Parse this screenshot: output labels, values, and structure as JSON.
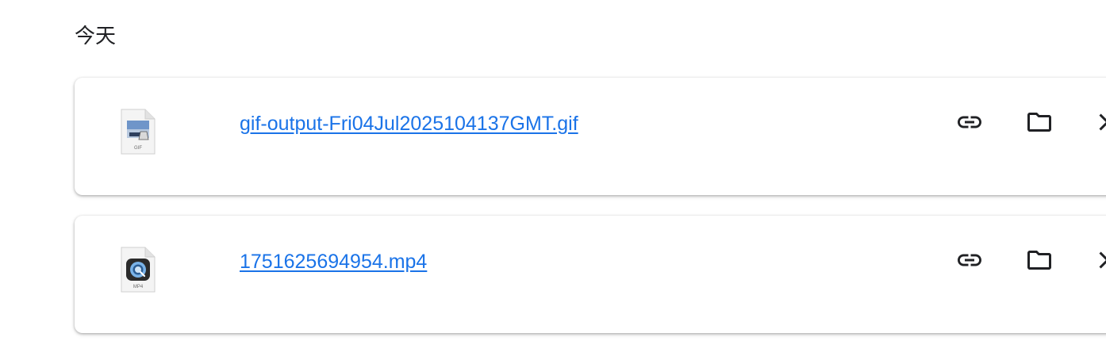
{
  "section": {
    "title": "今天"
  },
  "downloads": [
    {
      "file_name": "gif-output-Fri04Jul2025104137GMT.gif",
      "file_type_label": "GIF",
      "icon": "gif-file-icon"
    },
    {
      "file_name": "1751625694954.mp4",
      "file_type_label": "MP4",
      "icon": "mp4-file-icon"
    }
  ],
  "actions": {
    "copy_link_icon": "link-icon",
    "show_in_folder_icon": "folder-icon",
    "remove_icon": "close-icon"
  },
  "colors": {
    "link": "#1a73e8",
    "text": "#202124",
    "icon": "#202124"
  }
}
